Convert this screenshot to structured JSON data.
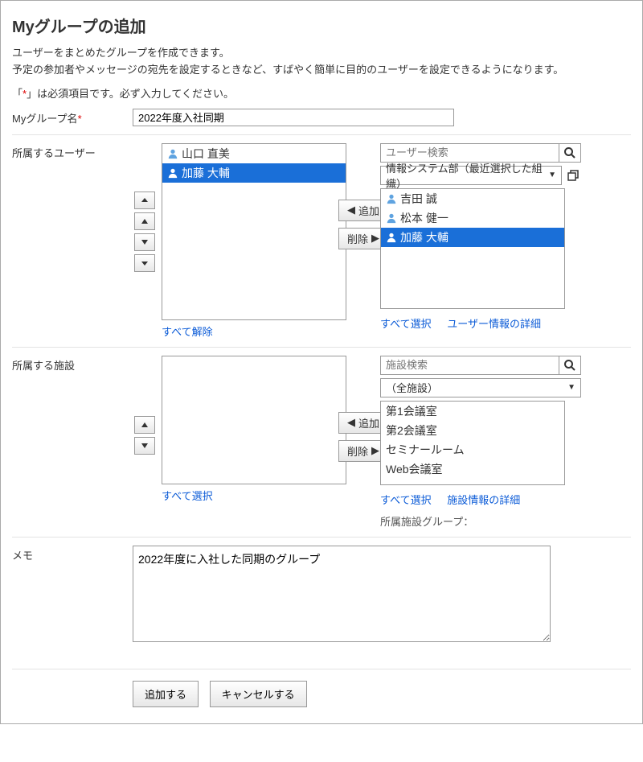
{
  "title": "Myグループの追加",
  "desc1": "ユーザーをまとめたグループを作成できます。",
  "desc2": "予定の参加者やメッセージの宛先を設定するときなど、すばやく簡単に目的のユーザーを設定できるようになります。",
  "req_note_pre": "「",
  "req_note_star": "*",
  "req_note_post": "」は必須項目です。必ず入力してください。",
  "labels": {
    "group_name": "Myグループ名",
    "users": "所属するユーザー",
    "facilities": "所属する施設",
    "memo": "メモ"
  },
  "group_name_value": "2022年度入社同期",
  "users": {
    "left": [
      {
        "name": "山口 直美",
        "selected": false
      },
      {
        "name": "加藤 大輔",
        "selected": true
      }
    ],
    "right": [
      {
        "name": "吉田 誠",
        "selected": false
      },
      {
        "name": "松本 健一",
        "selected": false
      },
      {
        "name": "加藤 大輔",
        "selected": true
      }
    ],
    "search_placeholder": "ユーザー検索",
    "org_select": "情報システム部（最近選択した組織）",
    "left_links": {
      "clear_all": "すべて解除"
    },
    "right_links": {
      "select_all": "すべて選択",
      "details": "ユーザー情報の詳細"
    }
  },
  "facilities": {
    "left": [],
    "right": [
      {
        "name": "第1会議室"
      },
      {
        "name": "第2会議室"
      },
      {
        "name": "セミナールーム"
      },
      {
        "name": "Web会議室"
      }
    ],
    "search_placeholder": "施設検索",
    "category_select": "（全施設）",
    "left_links": {
      "select_all": "すべて選択"
    },
    "right_links": {
      "select_all": "すべて選択",
      "details": "施設情報の詳細"
    },
    "group_note": "所属施設グループ："
  },
  "transfer_buttons": {
    "add": "追加",
    "remove": "削除"
  },
  "arrow_labels": {
    "top": "⤒",
    "up": "▲",
    "down": "▼",
    "bottom": "⤓"
  },
  "memo_value": "2022年度に入社した同期のグループ",
  "buttons": {
    "submit": "追加する",
    "cancel": "キャンセルする"
  }
}
